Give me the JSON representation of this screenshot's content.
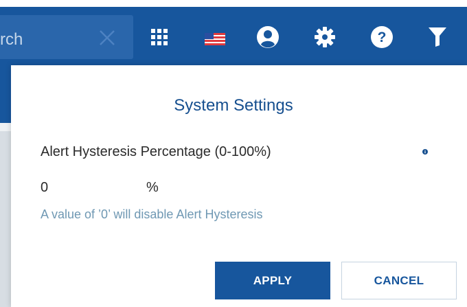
{
  "search": {
    "text": "rch"
  },
  "header_icons": [
    "grid-icon",
    "us-flag-icon",
    "user-icon",
    "gear-icon",
    "help-icon",
    "filter-icon"
  ],
  "dialog": {
    "title": "System Settings",
    "field_label": "Alert Hysteresis Percentage (0-100%)",
    "value": "0",
    "unit": "%",
    "hint": "A value of ’0’ will disable Alert Hysteresis",
    "apply_label": "APPLY",
    "cancel_label": "CANCEL"
  },
  "colors": {
    "header": "#17569d",
    "accent": "#164f8f",
    "hint": "#6f98b3"
  }
}
